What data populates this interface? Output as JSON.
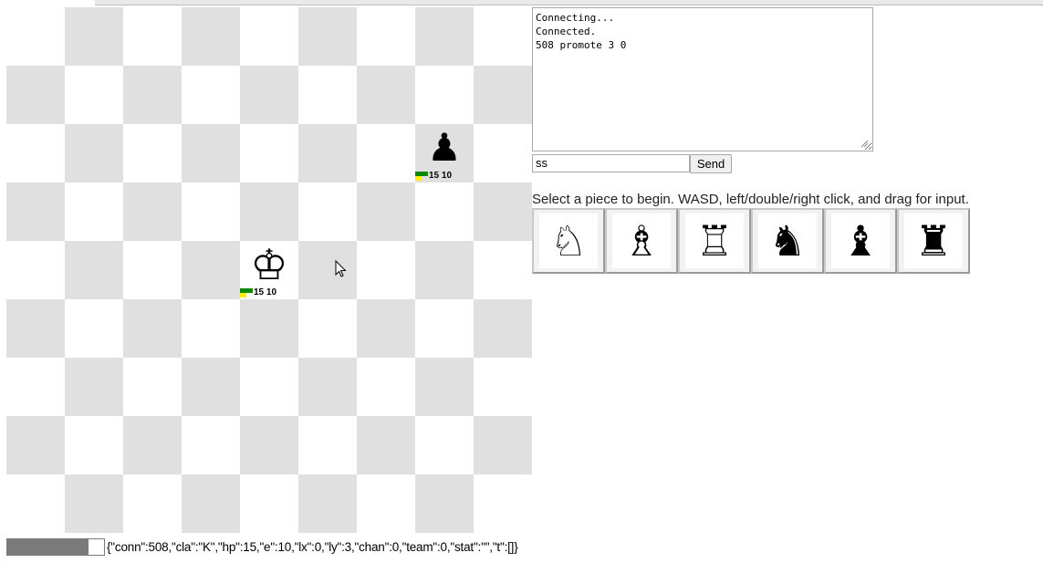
{
  "console": {
    "lines": [
      "Connecting...",
      "Connected.",
      "508 promote 3 0"
    ]
  },
  "command": {
    "value": "ss",
    "send_label": "Send"
  },
  "instructions": "Select a piece to begin. WASD, left/double/right click, and drag for input.",
  "board_pieces": [
    {
      "name": "black-pawn",
      "icon": "pawn-icon",
      "glyph": "♟",
      "hp": "15",
      "energy": "10"
    },
    {
      "name": "white-king",
      "icon": "king-icon",
      "glyph": "♔",
      "hp": "15",
      "energy": "10"
    }
  ],
  "piece_buttons": [
    {
      "name": "white-knight",
      "icon": "white-knight-icon",
      "glyph": "♘"
    },
    {
      "name": "white-bishop",
      "icon": "white-bishop-icon",
      "glyph": "♗"
    },
    {
      "name": "white-rook",
      "icon": "white-rook-icon",
      "glyph": "♖"
    },
    {
      "name": "black-knight",
      "icon": "black-knight-icon",
      "glyph": "♞"
    },
    {
      "name": "black-bishop",
      "icon": "black-bishop-icon",
      "glyph": "♝"
    },
    {
      "name": "black-rook",
      "icon": "black-rook-icon",
      "glyph": "♜"
    }
  ],
  "status": {
    "hp_fill": 0.82,
    "state_json": "{\"conn\":508,\"cla\":\"K\",\"hp\":15,\"e\":10,\"lx\":0,\"ly\":3,\"chan\":0,\"team\":0,\"stat\":\"\",\"t\":[]}"
  },
  "colors": {
    "light_square": "#ffffff",
    "dark_square": "#e0e0e0",
    "hp_green": "#0a8a00",
    "energy_yellow": "#ffee00"
  }
}
